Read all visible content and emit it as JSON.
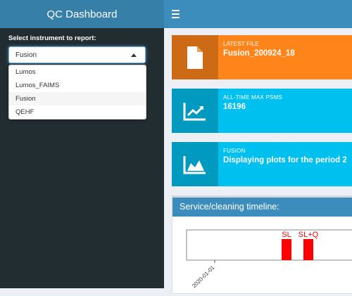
{
  "header": {
    "title": "QC Dashboard"
  },
  "sidebar": {
    "select_label": "Select instrument to report:",
    "selected": "Fusion",
    "options": [
      "Lumos",
      "Lumos_FAIMS",
      "Fusion",
      "QEHF"
    ]
  },
  "infoboxes": [
    {
      "label": "LATEST FILE",
      "value": "Fusion_200924_18",
      "icon": "file-icon",
      "color": "#ff851b",
      "icon_color": "#cc6a16"
    },
    {
      "label": "ALL-TIME MAX PSMS",
      "value": "16196",
      "icon": "line-chart-icon",
      "color": "#00c0ef",
      "icon_color": "#009ac0"
    },
    {
      "label": "FUSION",
      "value": "Displaying plots for the period 2",
      "icon": "area-chart-icon",
      "color": "#00c0ef",
      "icon_color": "#009ac0"
    }
  ],
  "timeline": {
    "title": "Service/cleaning timeline:",
    "chart_data": {
      "type": "bar",
      "x_tick_labels": [
        "2020-01-01"
      ],
      "bars": [
        {
          "label": "SL",
          "color": "#ff0000"
        },
        {
          "label": "SL+Q",
          "color": "#ff0000"
        }
      ]
    }
  }
}
